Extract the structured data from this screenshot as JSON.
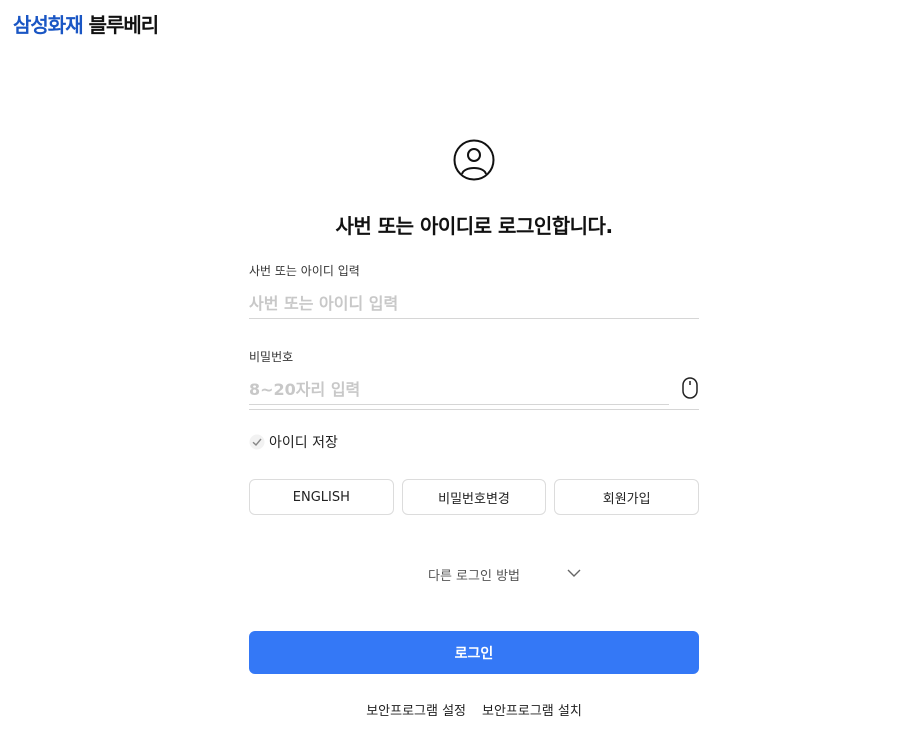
{
  "header": {
    "brand": "삼성화재",
    "product": "블루베리"
  },
  "login": {
    "heading": "사번 또는 아이디로 로그인합니다.",
    "id_field": {
      "label": "사번 또는 아이디 입력",
      "placeholder": "사번 또는 아이디 입력",
      "value": ""
    },
    "password_field": {
      "label": "비밀번호",
      "placeholder": "8~20자리 입력",
      "value": ""
    },
    "save_id": {
      "label": "아이디 저장",
      "checked": false
    },
    "buttons": {
      "english": "ENGLISH",
      "change_password": "비밀번호변경",
      "signup": "회원가입"
    },
    "other_login": "다른 로그인 방법",
    "submit": "로그인",
    "footer_links": [
      "보안프로그램 설정",
      "보안프로그램 설치"
    ]
  },
  "icons": {
    "user": "user-circle-icon",
    "mouse": "mouse-icon",
    "check": "check-icon",
    "chevron": "chevron-down-icon"
  },
  "colors": {
    "brand": "#1a56c4",
    "primary_button": "#3478f6"
  }
}
